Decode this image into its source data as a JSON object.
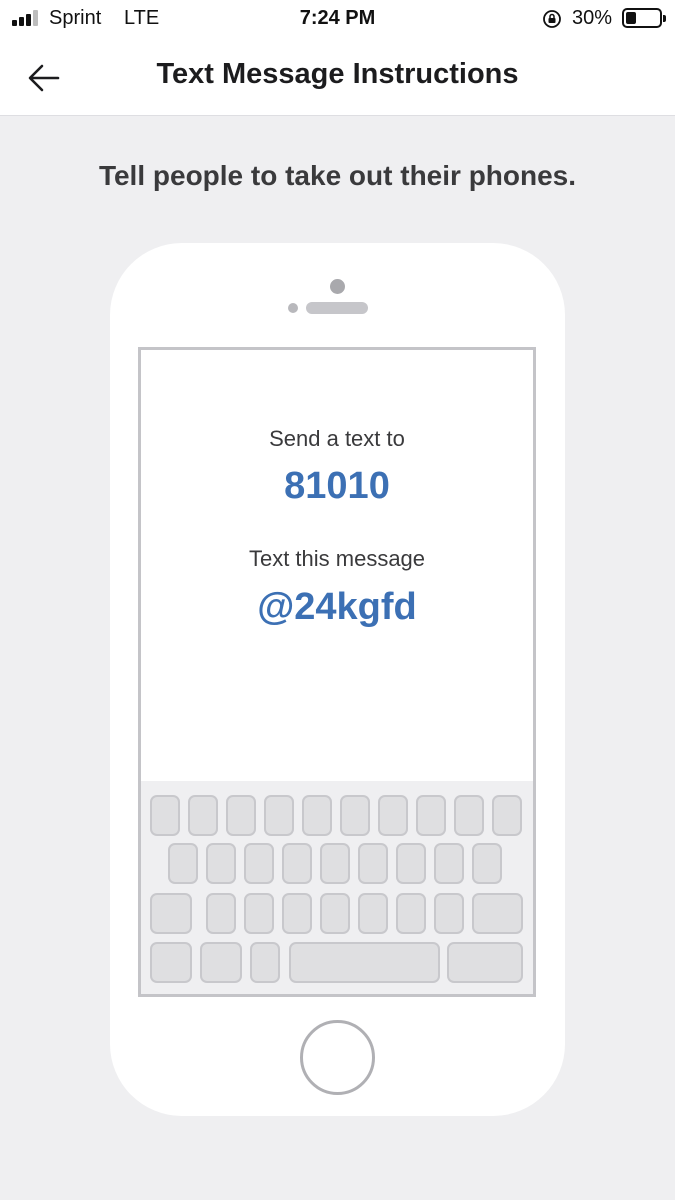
{
  "status_bar": {
    "carrier": "Sprint",
    "network": "LTE",
    "time": "7:24 PM",
    "battery_percent_text": "30%",
    "battery_level": 0.3,
    "icons": [
      "signal-icon",
      "orientation-lock-icon",
      "battery-icon"
    ]
  },
  "header": {
    "back_icon": "back-arrow-icon",
    "title": "Text Message Instructions"
  },
  "prompt": "Tell people to take out their phones.",
  "phone_screen": {
    "send_label": "Send a text to",
    "send_number": "81010",
    "message_label": "Text this message",
    "message_code": "@24kgfd"
  },
  "colors": {
    "accent": "#3c70b4",
    "background": "#efeff1",
    "surface": "#ffffff"
  }
}
